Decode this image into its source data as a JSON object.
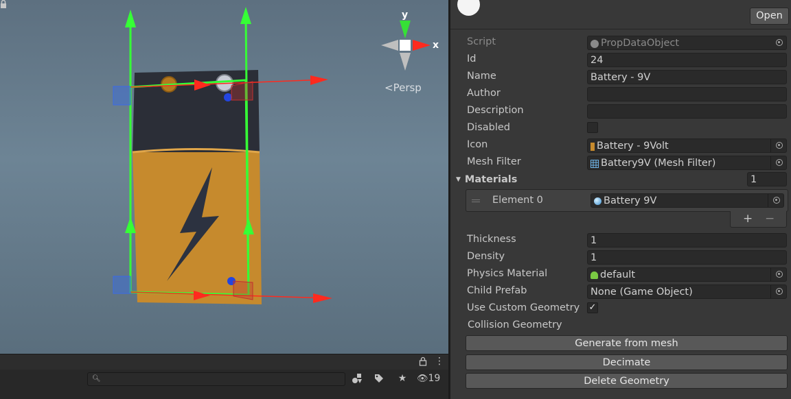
{
  "scene_view": {
    "projection_label": "Persp",
    "gizmo_axes": {
      "y": "y",
      "x": "x"
    }
  },
  "bottom_toolbar": {
    "search": {
      "value": "",
      "placeholder": ""
    },
    "hidden_count": "19",
    "icons": [
      "lock-icon",
      "kebab-menu-icon",
      "search-icon",
      "type-filter-icon",
      "label-filter-icon",
      "favorite-star-icon",
      "visibility-hidden-icon"
    ]
  },
  "inspector": {
    "open_button": "Open",
    "fields": {
      "script": {
        "label": "Script",
        "value": "PropDataObject"
      },
      "id": {
        "label": "Id",
        "value": "24"
      },
      "name": {
        "label": "Name",
        "value": "Battery - 9V"
      },
      "author": {
        "label": "Author",
        "value": ""
      },
      "description": {
        "label": "Description",
        "value": ""
      },
      "disabled": {
        "label": "Disabled",
        "checked": false
      },
      "icon": {
        "label": "Icon",
        "value": "Battery - 9Volt"
      },
      "mesh_filter": {
        "label": "Mesh Filter",
        "value": "Battery9V (Mesh Filter)"
      },
      "materials": {
        "label": "Materials",
        "size": "1",
        "element0_label": "Element 0",
        "element0_value": "Battery 9V"
      },
      "list_buttons": {
        "add": "+",
        "remove": "−"
      },
      "thickness": {
        "label": "Thickness",
        "value": "1"
      },
      "density": {
        "label": "Density",
        "value": "1"
      },
      "physics_material": {
        "label": "Physics Material",
        "value": "default"
      },
      "child_prefab": {
        "label": "Child Prefab",
        "value": "None (Game Object)"
      },
      "use_custom_geometry": {
        "label": "Use Custom Geometry",
        "checked": true,
        "check_glyph": "✓"
      },
      "collision_geometry": {
        "label": "Collision Geometry"
      }
    },
    "buttons": {
      "generate": "Generate from mesh",
      "decimate": "Decimate",
      "delete": "Delete Geometry"
    }
  },
  "colors": {
    "panel_bg": "#383838",
    "field_bg": "#2a2a2a",
    "button_bg": "#585858",
    "gizmo_green": "#39ff3a",
    "gizmo_red": "#ff2a1e",
    "battery_top": "#2a2d35",
    "battery_body": "#c88a2c"
  }
}
